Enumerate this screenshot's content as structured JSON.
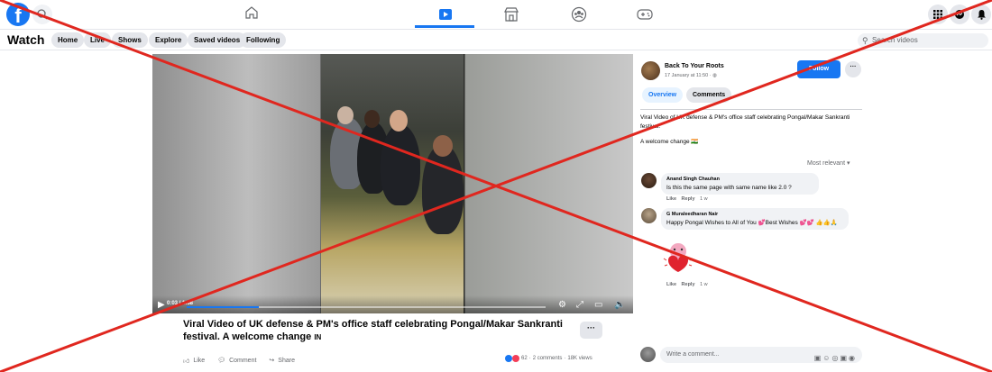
{
  "topbar": {
    "logo": "f",
    "nav_icons": [
      "home-icon",
      "watch-icon",
      "marketplace-icon",
      "groups-icon",
      "gaming-icon"
    ],
    "active_nav": "watch-icon",
    "right_icons": [
      "menu-grid-icon",
      "messenger-icon",
      "notifications-icon"
    ]
  },
  "subnav": {
    "title": "Watch",
    "chips": [
      "Home",
      "Live",
      "Shows",
      "Explore",
      "Saved videos",
      "Following"
    ],
    "search_placeholder": "Search videos"
  },
  "video": {
    "time": "0:03 / 1:58",
    "progress": 0.2,
    "title": "Viral Video of UK defense & PM's office staff celebrating Pongal/Makar Sankranti festival. A welcome change",
    "title_suffix": "IN",
    "more": "···",
    "actions": [
      "Like",
      "Comment",
      "Share"
    ],
    "reaction_count": "62",
    "comments_count": "2 comments",
    "views": "18K views"
  },
  "post": {
    "page_name": "Back To Your Roots",
    "date": "17 January at 11:50 · ",
    "follow_label": "Follow",
    "more": "···",
    "tabs": [
      "Overview",
      "Comments"
    ],
    "description": "Viral Video of UK defense & PM's office staff celebrating Pongal/Makar Sankranti festival.",
    "description2": "A welcome change 🇮🇳",
    "sort_label": "Most relevant ▾"
  },
  "comments": [
    {
      "name": "Anand Singh Chauhan",
      "text": "Is this the same page with same name like 2.0 ?",
      "like": "Like",
      "reply": "Reply",
      "age": "1 w"
    },
    {
      "name": "G Muraleedharan Nair",
      "text": "Happy Pongal Wishes to All of You 💕Best Wishes 💕💕 👍👍🙏",
      "like": "Like",
      "reply": "Reply",
      "age": "1 w"
    }
  ],
  "write_comment": {
    "placeholder": "Write a comment..."
  },
  "colors": {
    "brand": "#1877f2",
    "cross": "#e0271f"
  }
}
